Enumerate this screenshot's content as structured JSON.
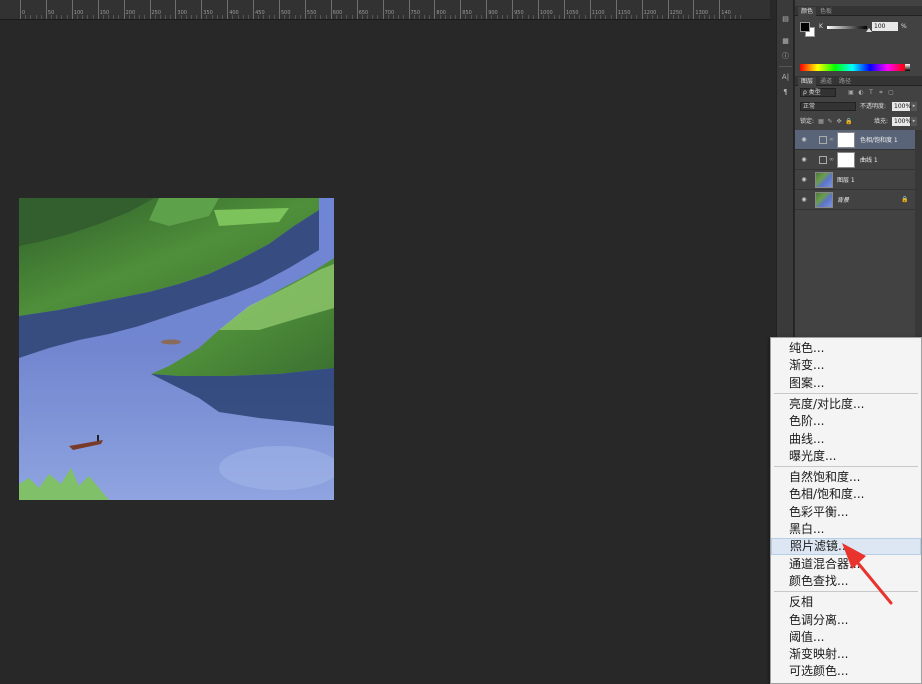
{
  "ruler": {
    "labels": [
      "0",
      "50",
      "100",
      "150",
      "200",
      "250",
      "300",
      "350",
      "400",
      "450",
      "500",
      "550",
      "600",
      "650",
      "700",
      "750",
      "800",
      "850",
      "900",
      "950",
      "1000",
      "1050",
      "1100",
      "1150",
      "1200",
      "1250",
      "1300",
      "140"
    ]
  },
  "color_panel": {
    "tabs": [
      "颜色",
      "色板"
    ],
    "channel_label": "K",
    "channel_value": "100",
    "percent": "%"
  },
  "layers_panel": {
    "tabs": [
      "图层",
      "通道",
      "路径"
    ],
    "filter_label": "ρ 类型",
    "blend_mode": "正常",
    "opacity_label": "不透明度:",
    "opacity_value": "100%",
    "lock_label": "锁定:",
    "fill_label": "填充:",
    "fill_value": "100%",
    "layers": [
      {
        "name": "色相/饱和度 1",
        "selected": true
      },
      {
        "name": "曲线 1",
        "selected": false
      },
      {
        "name": "图层 1",
        "selected": false
      },
      {
        "name": "背景",
        "selected": false
      }
    ]
  },
  "context_menu": {
    "groups": [
      [
        "纯色...",
        "渐变...",
        "图案..."
      ],
      [
        "亮度/对比度...",
        "色阶...",
        "曲线...",
        "曝光度..."
      ],
      [
        "自然饱和度...",
        "色相/饱和度...",
        "色彩平衡...",
        "黑白...",
        "照片滤镜...",
        "通道混合器...",
        "颜色查找..."
      ],
      [
        "反相",
        "色调分离...",
        "阈值...",
        "渐变映射...",
        "可选颜色..."
      ]
    ],
    "highlighted": "照片滤镜...",
    "annotation_color": "#e8342c"
  }
}
